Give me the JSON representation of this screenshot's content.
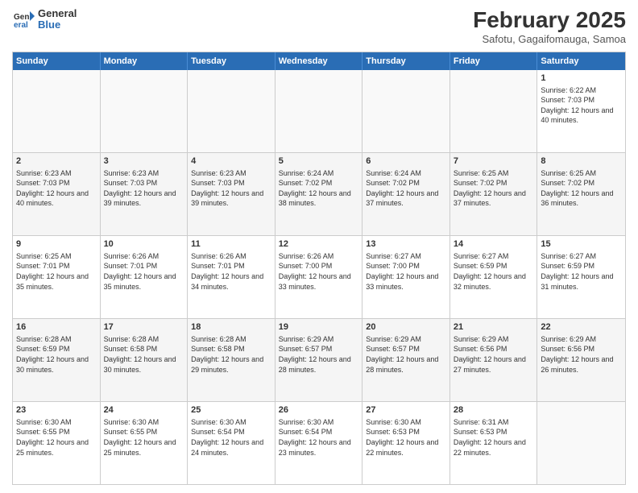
{
  "header": {
    "logo_general": "General",
    "logo_blue": "Blue",
    "month_title": "February 2025",
    "location": "Safotu, Gagaifomauga, Samoa"
  },
  "days_of_week": [
    "Sunday",
    "Monday",
    "Tuesday",
    "Wednesday",
    "Thursday",
    "Friday",
    "Saturday"
  ],
  "weeks": [
    [
      {
        "day": "",
        "info": ""
      },
      {
        "day": "",
        "info": ""
      },
      {
        "day": "",
        "info": ""
      },
      {
        "day": "",
        "info": ""
      },
      {
        "day": "",
        "info": ""
      },
      {
        "day": "",
        "info": ""
      },
      {
        "day": "1",
        "info": "Sunrise: 6:22 AM\nSunset: 7:03 PM\nDaylight: 12 hours and 40 minutes."
      }
    ],
    [
      {
        "day": "2",
        "info": "Sunrise: 6:23 AM\nSunset: 7:03 PM\nDaylight: 12 hours and 40 minutes."
      },
      {
        "day": "3",
        "info": "Sunrise: 6:23 AM\nSunset: 7:03 PM\nDaylight: 12 hours and 39 minutes."
      },
      {
        "day": "4",
        "info": "Sunrise: 6:23 AM\nSunset: 7:03 PM\nDaylight: 12 hours and 39 minutes."
      },
      {
        "day": "5",
        "info": "Sunrise: 6:24 AM\nSunset: 7:02 PM\nDaylight: 12 hours and 38 minutes."
      },
      {
        "day": "6",
        "info": "Sunrise: 6:24 AM\nSunset: 7:02 PM\nDaylight: 12 hours and 37 minutes."
      },
      {
        "day": "7",
        "info": "Sunrise: 6:25 AM\nSunset: 7:02 PM\nDaylight: 12 hours and 37 minutes."
      },
      {
        "day": "8",
        "info": "Sunrise: 6:25 AM\nSunset: 7:02 PM\nDaylight: 12 hours and 36 minutes."
      }
    ],
    [
      {
        "day": "9",
        "info": "Sunrise: 6:25 AM\nSunset: 7:01 PM\nDaylight: 12 hours and 35 minutes."
      },
      {
        "day": "10",
        "info": "Sunrise: 6:26 AM\nSunset: 7:01 PM\nDaylight: 12 hours and 35 minutes."
      },
      {
        "day": "11",
        "info": "Sunrise: 6:26 AM\nSunset: 7:01 PM\nDaylight: 12 hours and 34 minutes."
      },
      {
        "day": "12",
        "info": "Sunrise: 6:26 AM\nSunset: 7:00 PM\nDaylight: 12 hours and 33 minutes."
      },
      {
        "day": "13",
        "info": "Sunrise: 6:27 AM\nSunset: 7:00 PM\nDaylight: 12 hours and 33 minutes."
      },
      {
        "day": "14",
        "info": "Sunrise: 6:27 AM\nSunset: 6:59 PM\nDaylight: 12 hours and 32 minutes."
      },
      {
        "day": "15",
        "info": "Sunrise: 6:27 AM\nSunset: 6:59 PM\nDaylight: 12 hours and 31 minutes."
      }
    ],
    [
      {
        "day": "16",
        "info": "Sunrise: 6:28 AM\nSunset: 6:59 PM\nDaylight: 12 hours and 30 minutes."
      },
      {
        "day": "17",
        "info": "Sunrise: 6:28 AM\nSunset: 6:58 PM\nDaylight: 12 hours and 30 minutes."
      },
      {
        "day": "18",
        "info": "Sunrise: 6:28 AM\nSunset: 6:58 PM\nDaylight: 12 hours and 29 minutes."
      },
      {
        "day": "19",
        "info": "Sunrise: 6:29 AM\nSunset: 6:57 PM\nDaylight: 12 hours and 28 minutes."
      },
      {
        "day": "20",
        "info": "Sunrise: 6:29 AM\nSunset: 6:57 PM\nDaylight: 12 hours and 28 minutes."
      },
      {
        "day": "21",
        "info": "Sunrise: 6:29 AM\nSunset: 6:56 PM\nDaylight: 12 hours and 27 minutes."
      },
      {
        "day": "22",
        "info": "Sunrise: 6:29 AM\nSunset: 6:56 PM\nDaylight: 12 hours and 26 minutes."
      }
    ],
    [
      {
        "day": "23",
        "info": "Sunrise: 6:30 AM\nSunset: 6:55 PM\nDaylight: 12 hours and 25 minutes."
      },
      {
        "day": "24",
        "info": "Sunrise: 6:30 AM\nSunset: 6:55 PM\nDaylight: 12 hours and 25 minutes."
      },
      {
        "day": "25",
        "info": "Sunrise: 6:30 AM\nSunset: 6:54 PM\nDaylight: 12 hours and 24 minutes."
      },
      {
        "day": "26",
        "info": "Sunrise: 6:30 AM\nSunset: 6:54 PM\nDaylight: 12 hours and 23 minutes."
      },
      {
        "day": "27",
        "info": "Sunrise: 6:30 AM\nSunset: 6:53 PM\nDaylight: 12 hours and 22 minutes."
      },
      {
        "day": "28",
        "info": "Sunrise: 6:31 AM\nSunset: 6:53 PM\nDaylight: 12 hours and 22 minutes."
      },
      {
        "day": "",
        "info": ""
      }
    ]
  ]
}
